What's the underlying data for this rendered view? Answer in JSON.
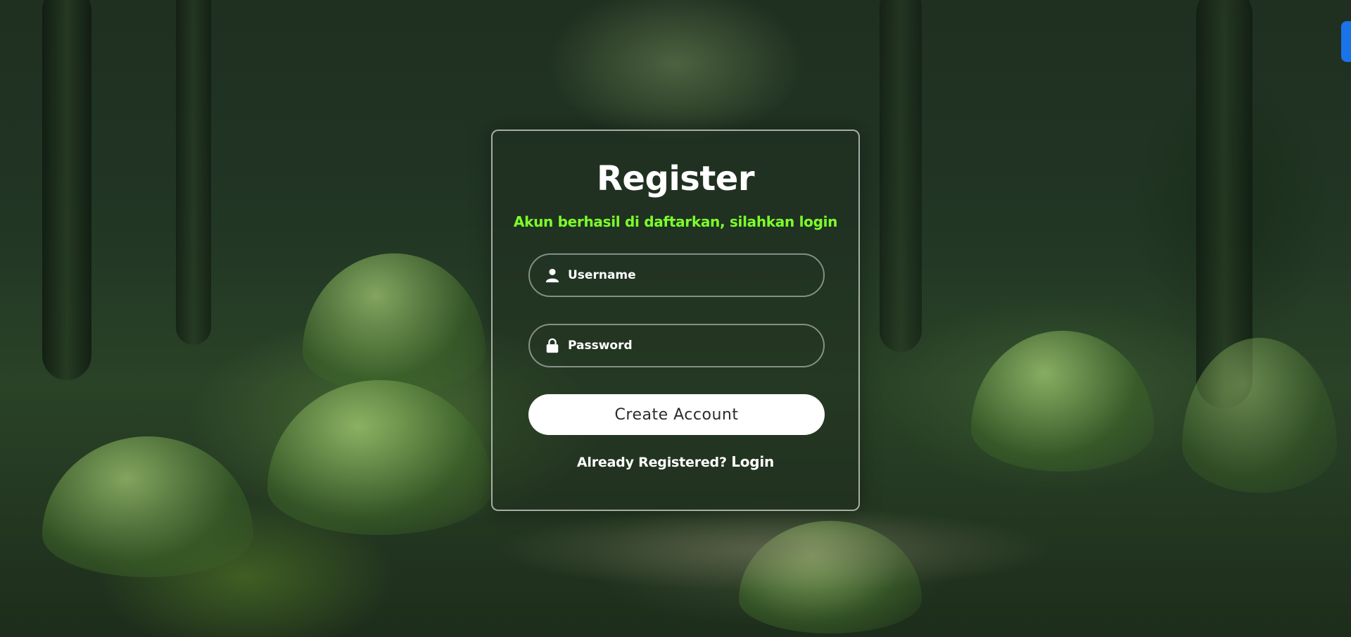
{
  "form": {
    "title": "Register",
    "success_message": "Akun berhasil di daftarkan, silahkan login",
    "username_placeholder": "Username",
    "password_placeholder": "Password",
    "submit_label": "Create Account",
    "footer_text": "Already Registered?",
    "login_link": "Login"
  },
  "icons": {
    "username": "user-icon",
    "password": "lock-icon"
  },
  "colors": {
    "success_message": "#7cff2b",
    "button_background": "#ffffff",
    "edge_tab": "#1a73e8"
  }
}
